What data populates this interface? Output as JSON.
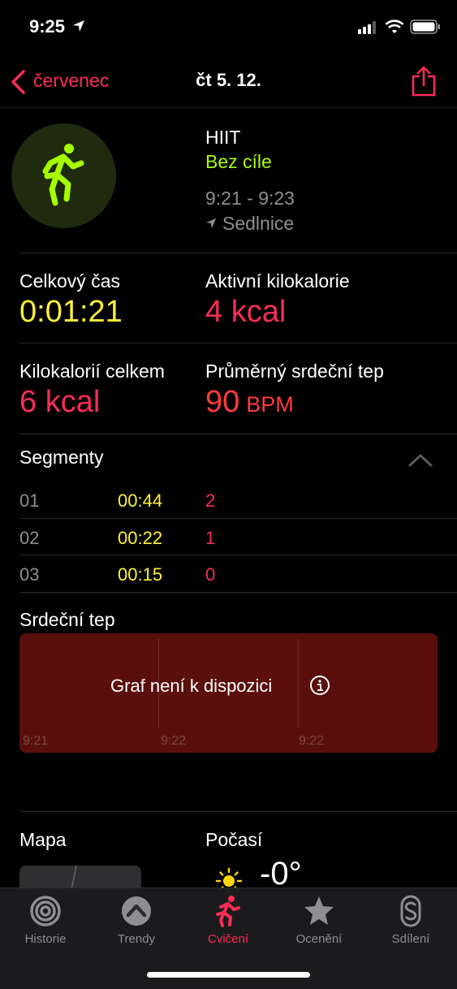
{
  "status_bar": {
    "time": "9:25"
  },
  "nav": {
    "back_label": "červenec",
    "title": "čt 5. 12."
  },
  "workout": {
    "name": "HIIT",
    "goal": "Bez cíle",
    "time_range": "9:21 - 9:23",
    "location": "Sedlnice"
  },
  "metrics": {
    "total_time_label": "Celkový čas",
    "total_time_value": "0:01:21",
    "active_kcal_label": "Aktivní kilokalorie",
    "active_kcal_value": "4 kcal",
    "total_kcal_label": "Kilokalorií celkem",
    "total_kcal_value": "6 kcal",
    "avg_hr_label": "Průměrný srdeční tep",
    "avg_hr_value": "90",
    "avg_hr_unit": "BPM"
  },
  "segments": {
    "title": "Segmenty",
    "rows": [
      {
        "num": "01",
        "time": "00:44",
        "value": "2"
      },
      {
        "num": "02",
        "time": "00:22",
        "value": "1"
      },
      {
        "num": "03",
        "time": "00:15",
        "value": "0"
      }
    ]
  },
  "heart_rate": {
    "title": "Srdeční tep",
    "message": "Graf není k dispozici",
    "ticks": [
      "9:21",
      "9:22",
      "9:22"
    ]
  },
  "map": {
    "title": "Mapa"
  },
  "weather": {
    "title": "Počasí",
    "temperature": "-0°"
  },
  "tabs": [
    {
      "label": "Historie",
      "icon": "history-rings-icon"
    },
    {
      "label": "Trendy",
      "icon": "trends-chevron-icon"
    },
    {
      "label": "Cvičení",
      "icon": "workout-runner-icon",
      "active": true
    },
    {
      "label": "Ocenění",
      "icon": "awards-star-icon"
    },
    {
      "label": "Sdílení",
      "icon": "sharing-icon"
    }
  ],
  "colors": {
    "accent_red": "#fa2d55",
    "yellow": "#fff23a",
    "green": "#a6ff00",
    "chart_bg": "#5a0f0c"
  }
}
